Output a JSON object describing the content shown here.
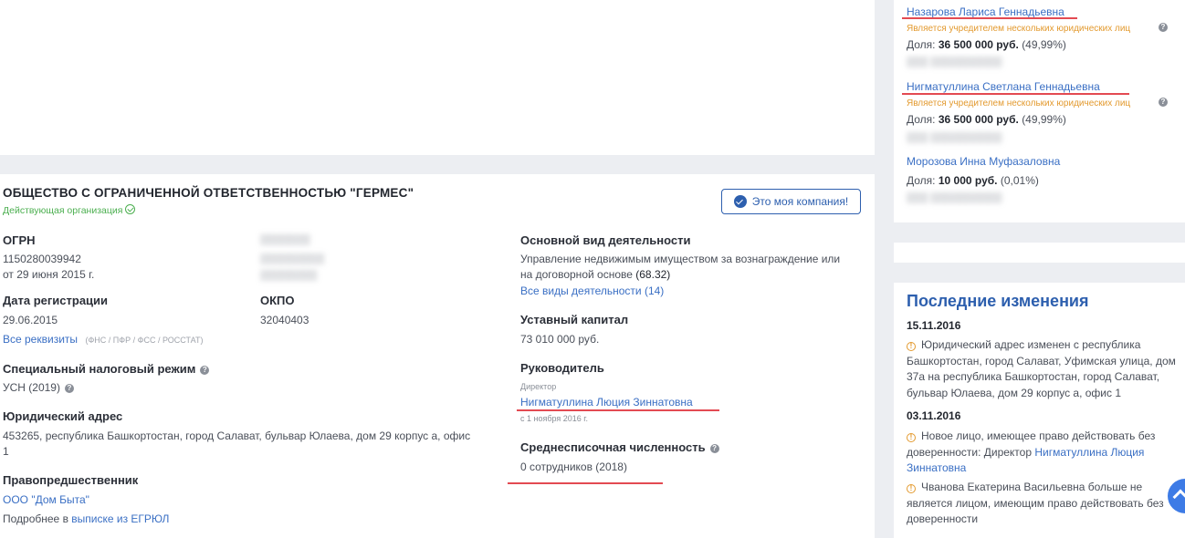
{
  "company": {
    "title": "ОБЩЕСТВО С ОГРАНИЧЕННОЙ ОТВЕТСТВЕННОСТЬЮ \"ГЕРМЕС\"",
    "status": "Действующая организация",
    "my_company_button": "Это моя компания!"
  },
  "ogrn": {
    "label": "ОГРН",
    "value": "1150280039942",
    "date": "от 29 июня 2015 г."
  },
  "registration": {
    "label": "Дата регистрации",
    "value": "29.06.2015"
  },
  "okpo": {
    "label": "ОКПО",
    "value": "32040403"
  },
  "requisites": {
    "link": "Все реквизиты",
    "note": "(ФНС / ПФР / ФСС / РОССТАТ)"
  },
  "tax_regime": {
    "label": "Специальный налоговый режим",
    "value": "УСН (2019)"
  },
  "address": {
    "label": "Юридический адрес",
    "line1": "453265, республика Башкортостан, город Салават, бульвар Юлаева, дом 29 корпус а, офис",
    "line2": "1"
  },
  "predecessor": {
    "label": "Правопредшественник",
    "value": "ООО \"Дом Быта\"",
    "more_prefix": "Подробнее в",
    "more_link": "выписке из ЕГРЮЛ"
  },
  "activity": {
    "label": "Основной вид деятельности",
    "line1": "Управление недвижимым имуществом за вознаграждение или",
    "line2_text": "на договорной основе",
    "line2_code": "(68.32)",
    "all_link": "Все виды деятельности (14)"
  },
  "capital": {
    "label": "Уставный капитал",
    "value": "73 010 000 руб."
  },
  "head": {
    "label": "Руководитель",
    "position": "Директор",
    "name": "Нигматуллина Люция Зиннатовна",
    "since": "с 1 ноября 2016 г."
  },
  "employees": {
    "label": "Среднесписочная численность",
    "value": "0 сотрудников (2018)"
  },
  "founders": [
    {
      "name": "Назарова Лариса Геннадьевна",
      "note": "Является учредителем нескольких юридических лиц",
      "share_label": "Доля:",
      "share_value": "36 500 000 руб.",
      "share_pct": "(49,99%)"
    },
    {
      "name": "Нигматуллина Светлана Геннадьевна",
      "note": "Является учредителем нескольких юридических лиц",
      "share_label": "Доля:",
      "share_value": "36 500 000 руб.",
      "share_pct": "(49,99%)"
    },
    {
      "name": "Морозова Инна Муфазаловна",
      "note": "",
      "share_label": "Доля:",
      "share_value": "10 000 руб.",
      "share_pct": "(0,01%)"
    }
  ],
  "changes": {
    "title": "Последние изменения",
    "entries": [
      {
        "date": "15.11.2016",
        "items": [
          {
            "text": "Юридический адрес изменен с республика Башкортостан, город Салават, Уфимская улица, дом 37а на республика Башкортостан, город Салават, бульвар Юлаева, дом 29 корпус а, офис 1"
          }
        ]
      },
      {
        "date": "03.11.2016",
        "items": [
          {
            "text": "Новое лицо, имеющее право действовать без доверенности: Директор",
            "link": "Нигматуллина Люция Зиннатовна"
          },
          {
            "text": "Чванова Екатерина Васильевна больше не является лицом, имеющим право действовать без доверенности"
          }
        ]
      }
    ]
  },
  "colors": {
    "accent": "#2d5fae",
    "link": "#3a6fc4",
    "active": "#4caf50",
    "underline": "#e34a52",
    "warning": "#e39a2f"
  }
}
